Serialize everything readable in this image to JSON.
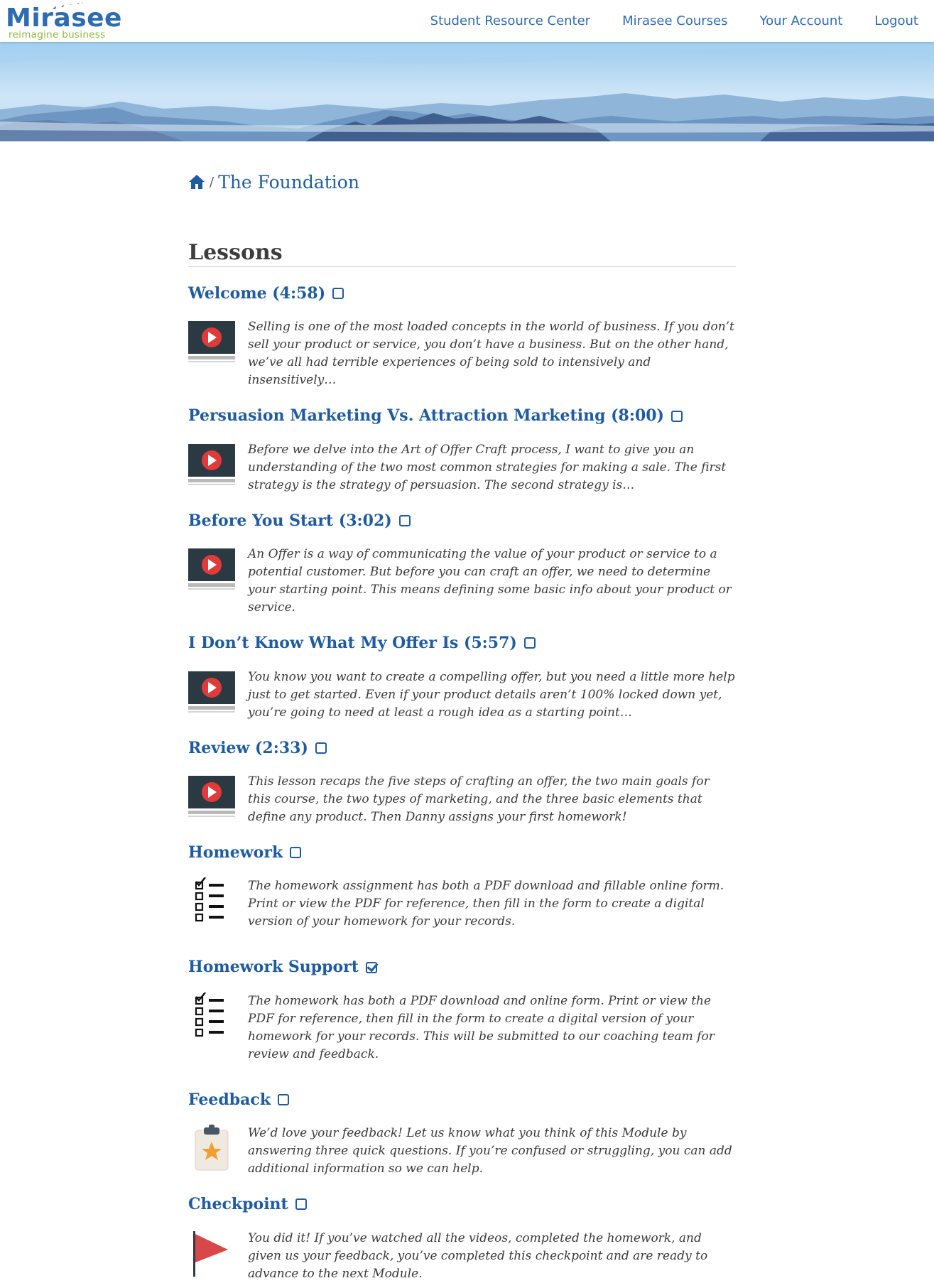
{
  "header": {
    "logo_word": "Mirasee",
    "logo_tagline": "reimagine business",
    "nav": [
      {
        "label": "Student Resource Center"
      },
      {
        "label": "Mirasee Courses"
      },
      {
        "label": "Your Account"
      },
      {
        "label": "Logout"
      }
    ]
  },
  "breadcrumb": {
    "home_icon": "home-icon",
    "separator": "/",
    "current": "The Foundation"
  },
  "lessons_heading": "Lessons",
  "lessons": [
    {
      "title": "Welcome (4:58)",
      "completed": false,
      "icon": "video-play-icon",
      "description": "Selling is one of the most loaded concepts in the world of business. If you don’t sell your product or service, you don’t have a business. But on the other hand, we’ve all had terrible experiences of being sold to intensively and insensitively…"
    },
    {
      "title": "Persuasion Marketing Vs. Attraction Marketing (8:00)",
      "completed": false,
      "icon": "video-play-icon",
      "description": "Before we delve into the Art of Offer Craft process, I want to give you an understanding of the two most common strategies for making a sale. The first strategy is the strategy of persuasion. The second strategy is…"
    },
    {
      "title": "Before You Start (3:02)",
      "completed": false,
      "icon": "video-play-icon",
      "description": "An Offer is a way of communicating the value of your product or service to a potential customer. But before you can craft an offer, we need to determine your starting point. This means defining some basic info about your product or service."
    },
    {
      "title": "I Don’t Know What My Offer Is (5:57)",
      "completed": false,
      "icon": "video-play-icon",
      "description": "You know you want to create a compelling offer, but you need a little more help just to get started. Even if your product details aren’t 100% locked down yet, you’re going to need at least a rough idea as a starting point…"
    },
    {
      "title": "Review (2:33)",
      "completed": false,
      "icon": "video-play-icon",
      "description": "This lesson recaps the five steps of crafting an offer, the two main goals for this course, the two types of marketing, and the three basic elements that define any product. Then Danny assigns your first homework!"
    },
    {
      "title": "Homework",
      "completed": false,
      "icon": "checklist-icon",
      "description": "The homework assignment has both a PDF download and fillable online form. Print or view the PDF for reference, then fill in the form to create a digital version of your homework for your records."
    },
    {
      "title": "Homework Support",
      "completed": true,
      "icon": "checklist-icon",
      "description": "The homework has both a PDF download and online form. Print or view the PDF for reference, then fill in the form to create a digital version of your homework for your records. This will be submitted to our coaching team for review and feedback."
    },
    {
      "title": "Feedback",
      "completed": false,
      "icon": "clipboard-star-icon",
      "description": "We’d love your feedback! Let us know what you think of this Module by answering three quick questions. If you’re confused or struggling, you can add additional information so we can help."
    },
    {
      "title": "Checkpoint",
      "completed": false,
      "icon": "red-flag-icon",
      "description": "You did it! If you’ve watched all the videos, completed the homework, and given us your feedback, you’ve completed this checkpoint and are ready to advance to the next Module."
    }
  ],
  "colors": {
    "link_blue": "#1f5ba1",
    "nav_blue": "#2f6bb0",
    "logo_blue": "#2d6bb3",
    "logo_green": "#8fb73e",
    "video_icon_bg": "#2b3a42",
    "play_red": "#e03a3a",
    "flag_red": "#d94848",
    "star_orange": "#f0a030"
  }
}
